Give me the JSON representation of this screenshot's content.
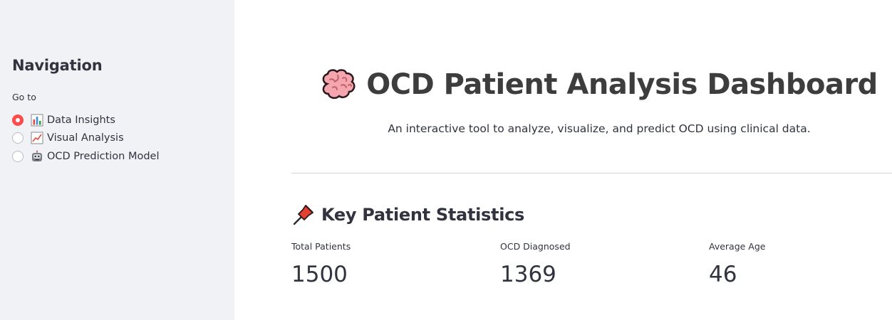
{
  "sidebar": {
    "title": "Navigation",
    "radio_label": "Go to",
    "options": [
      {
        "label": "Data Insights",
        "icon": "bar-chart-icon",
        "selected": true
      },
      {
        "label": "Visual Analysis",
        "icon": "trend-chart-icon",
        "selected": false
      },
      {
        "label": "OCD Prediction Model",
        "icon": "robot-icon",
        "selected": false
      }
    ]
  },
  "main": {
    "title": "OCD Patient Analysis Dashboard",
    "title_icon": "brain-icon",
    "subtitle": "An interactive tool to analyze, visualize, and predict OCD using clinical data.",
    "section": {
      "title": "Key Patient Statistics",
      "icon": "pushpin-icon"
    },
    "metrics": [
      {
        "label": "Total Patients",
        "value": "1500"
      },
      {
        "label": "OCD Diagnosed",
        "value": "1369"
      },
      {
        "label": "Average Age",
        "value": "46"
      }
    ]
  },
  "colors": {
    "sidebar_bg": "#f0f2f6",
    "accent": "#ff4b4b",
    "text": "#31333f",
    "divider": "#d6d6d9"
  }
}
